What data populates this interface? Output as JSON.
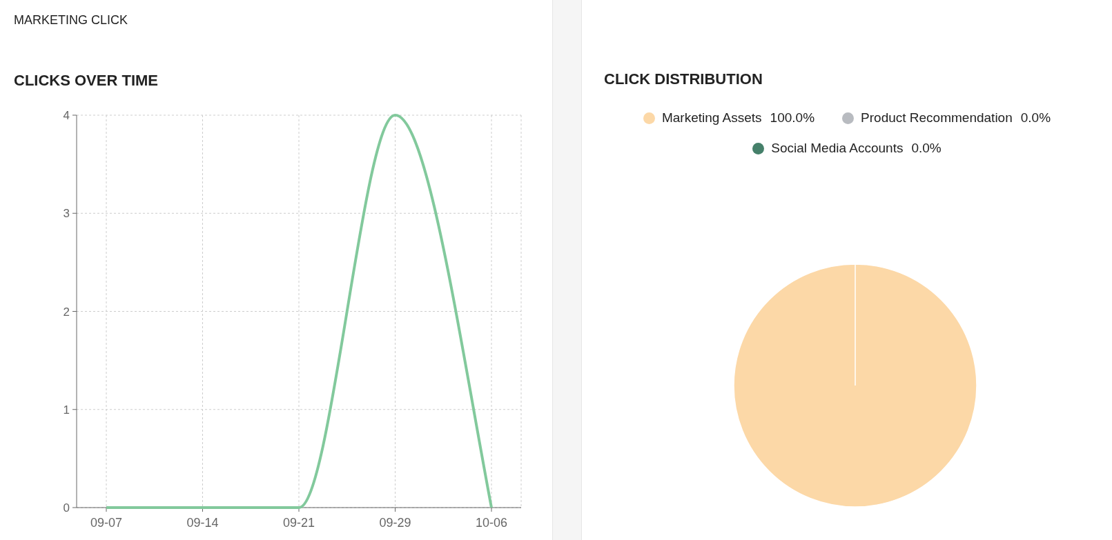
{
  "page_title": "MARKETING CLICK",
  "clicks_over_time": {
    "title": "CLICKS OVER TIME",
    "chart_data": {
      "type": "line",
      "categories": [
        "09-07",
        "09-14",
        "09-21",
        "09-29",
        "10-06"
      ],
      "series": [
        {
          "color": "#82c99c",
          "values": [
            0,
            0,
            0,
            4,
            0
          ]
        }
      ],
      "ylim": [
        0,
        4
      ],
      "yticks": [
        0,
        1,
        2,
        3,
        4
      ],
      "grid": true
    }
  },
  "click_distribution": {
    "title": "CLICK DISTRIBUTION",
    "legend": [
      {
        "label": "Marketing Assets",
        "percent": "100.0%",
        "color": "#fcd8a7"
      },
      {
        "label": "Product Recommendation",
        "percent": "0.0%",
        "color": "#b8bbc0"
      },
      {
        "label": "Social Media Accounts",
        "percent": "0.0%",
        "color": "#45806a"
      }
    ],
    "chart_data": {
      "type": "pie",
      "values": [
        100,
        0,
        0
      ]
    }
  }
}
